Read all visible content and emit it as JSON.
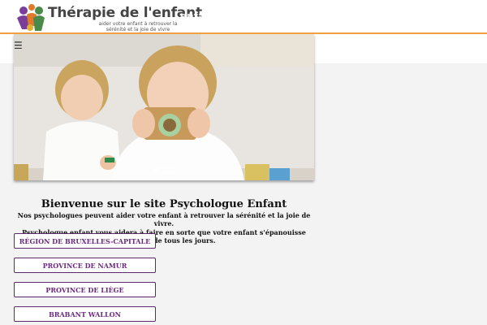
{
  "header": {
    "logo_title": "Thérapie de l'enfant",
    "logo_tagline": "aider votre enfant à retrouver la sérénité et la joie de vivre",
    "ghost_title": "enfant",
    "menu_icon": "☰",
    "accent_color": "#f0a040"
  },
  "slider": {
    "slides": 3,
    "active_index": 0
  },
  "intro": {
    "heading": "Bienvenue sur le site Psychologue Enfant",
    "line1": "Nos psychologues peuvent aider votre enfant à retrouver la sérénité et la joie de vivre.",
    "line2": "Psychologue enfant vous aidera à faire en sorte que votre enfant s'épanouisse dans la vie de tous les jours."
  },
  "regions": [
    {
      "label": "RÉGION DE BRUXELLES-CAPITALE"
    },
    {
      "label": "PROVINCE DE NAMUR"
    },
    {
      "label": "PROVINCE DE LIÈGE"
    },
    {
      "label": "BRABANT WALLON"
    }
  ],
  "colors": {
    "brand_purple": "#6a2a7e",
    "button_border": "#5a2a6b"
  }
}
